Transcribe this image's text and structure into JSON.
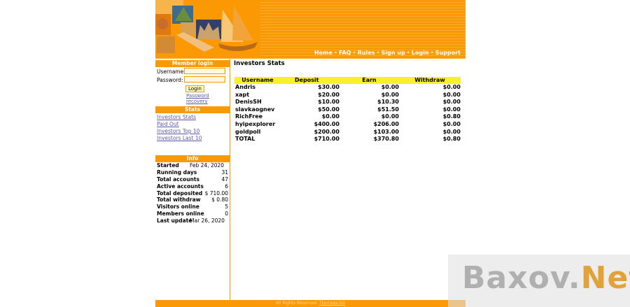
{
  "nav": [
    "Home",
    "FAQ",
    "Rules",
    "Sign up",
    "Login",
    "Support"
  ],
  "login": {
    "title": "Member login",
    "username_label": "Username:",
    "password_label": "Password:",
    "button": "Login",
    "recovery": "Password recovery"
  },
  "stats": {
    "title": "Stats",
    "links": [
      "Investors Stats",
      "Paid Out",
      "Investors Top 10",
      "Investors Last 10"
    ]
  },
  "info": {
    "title": "Info",
    "rows": [
      {
        "k": "Started",
        "v": "Feb 24, 2020"
      },
      {
        "k": "Running days",
        "v": "31"
      },
      {
        "k": "Total accounts",
        "v": "47"
      },
      {
        "k": "Active accounts",
        "v": "6"
      },
      {
        "k": "Total deposited",
        "v": "$ 710.00"
      },
      {
        "k": "Total withdraw",
        "v": "$ 0.80"
      },
      {
        "k": "Visitors online",
        "v": "5"
      },
      {
        "k": "Members online",
        "v": "0"
      },
      {
        "k": "Last update",
        "v": "Mar 26, 2020"
      }
    ]
  },
  "main": {
    "title": "Investors Stats",
    "columns": [
      "Username",
      "Deposit",
      "Earn",
      "Withdraw"
    ],
    "rows": [
      [
        "Andris",
        "$30.00",
        "$0.00",
        "$0.00"
      ],
      [
        "xapt",
        "$20.00",
        "$0.00",
        "$0.00"
      ],
      [
        "DenisSH",
        "$10.00",
        "$10.30",
        "$0.00"
      ],
      [
        "slavkaognev",
        "$50.00",
        "$51.50",
        "$0.00"
      ],
      [
        "RichFree",
        "$0.00",
        "$0.00",
        "$0.80"
      ],
      [
        "hyipexplorer",
        "$400.00",
        "$206.00",
        "$0.00"
      ],
      [
        "goldpoll",
        "$200.00",
        "$103.00",
        "$0.00"
      ],
      [
        "TOTAL",
        "$710.00",
        "$370.80",
        "$0.80"
      ]
    ]
  },
  "footer": {
    "text": "All Rights Reserved.",
    "link": "Tkorrada.biz"
  },
  "watermark": {
    "part1": "Baxov.",
    "part2": "Net"
  }
}
